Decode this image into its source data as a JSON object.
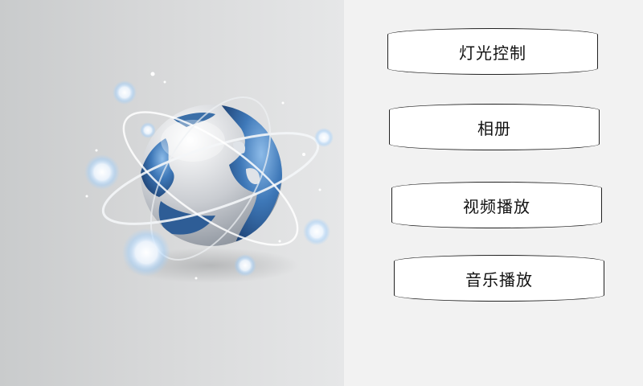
{
  "menu": {
    "items": [
      {
        "label": "灯光控制"
      },
      {
        "label": "相册"
      },
      {
        "label": "视频播放"
      },
      {
        "label": "音乐播放"
      }
    ]
  },
  "colors": {
    "left_bg": "#d3d4d5",
    "right_bg": "#f2f2f2",
    "globe_ocean": "#3f7fc0",
    "globe_land": "#c8ccd2",
    "button_bg": "#ffffff",
    "button_border": "#222222"
  },
  "icons": {
    "hero": "globe-icon"
  }
}
